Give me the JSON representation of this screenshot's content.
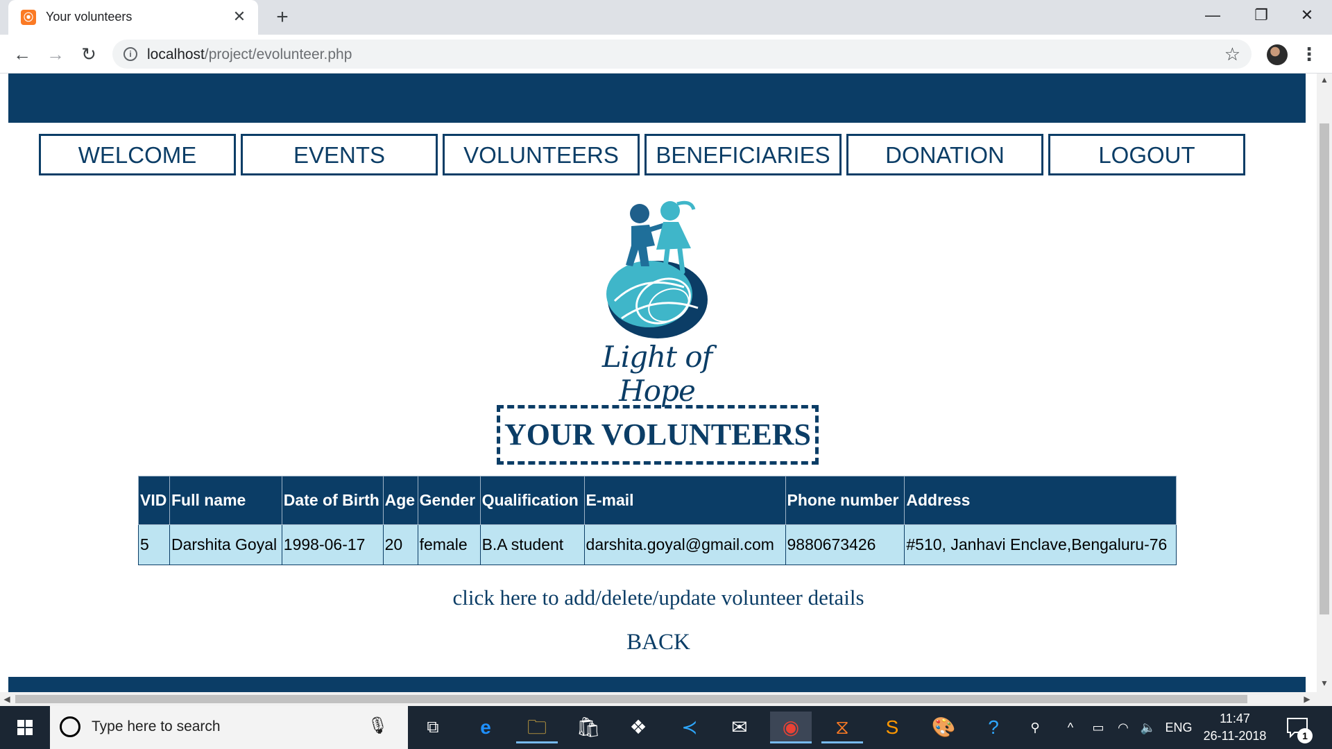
{
  "browser": {
    "tab_title": "Your volunteers",
    "favicon_glyph": "⦿",
    "url_host": "localhost",
    "url_path": "/project/evolunteer.php"
  },
  "nav": {
    "items": [
      {
        "label": "WELCOME"
      },
      {
        "label": "EVENTS"
      },
      {
        "label": "VOLUNTEERS"
      },
      {
        "label": "BENEFICIARIES"
      },
      {
        "label": "DONATION"
      },
      {
        "label": "LOGOUT"
      }
    ]
  },
  "logo": {
    "text": "Light of Hope"
  },
  "page": {
    "heading": "YOUR VOLUNTEERS",
    "edit_link": "click here to add/delete/update volunteer details",
    "back_link": "BACK"
  },
  "table": {
    "columns": [
      "VID",
      "Full name",
      "Date of Birth",
      "Age",
      "Gender",
      "Qualification",
      "E-mail",
      "Phone number",
      "Address"
    ],
    "rows": [
      [
        "5",
        "Darshita Goyal",
        "1998-06-17",
        "20",
        "female",
        "B.A student",
        "darshita.goyal@gmail.com",
        "9880673426",
        "#510, Janhavi Enclave,Bengaluru-76"
      ]
    ]
  },
  "taskbar": {
    "search_placeholder": "Type here to search",
    "language": "ENG",
    "time": "11:47",
    "date": "26-11-2018",
    "notification_count": "1"
  },
  "colors": {
    "brand_navy": "#0b3d66",
    "row_background": "#bde4f2",
    "logo_teal": "#3fb6c9"
  }
}
